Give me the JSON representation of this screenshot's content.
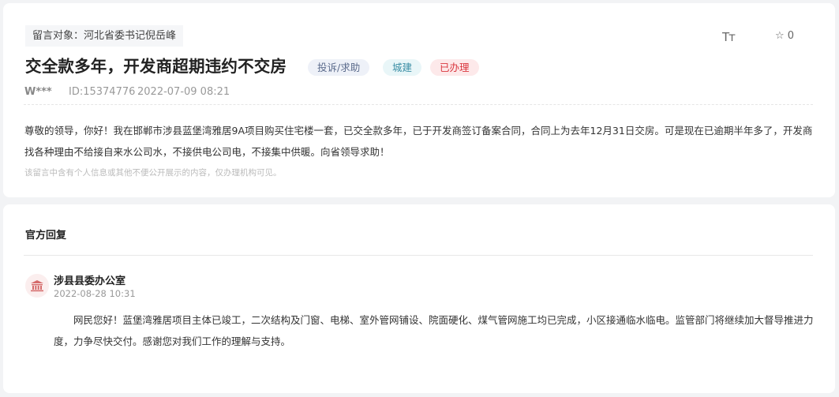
{
  "message": {
    "target": "留言对象：河北省委书记倪岳峰",
    "title": "交全款多年，开发商超期违约不交房",
    "tags": [
      "投诉/求助",
      "城建",
      "已办理"
    ],
    "font_size_icon_label": "Tт",
    "favorite_count": "☆ 0",
    "author": "W***",
    "id": "ID:15374776",
    "date": "2022-07-09 08:21",
    "content": "尊敬的领导，你好！我在邯郸市涉县蓝堡湾雅居9A项目购买住宅楼一套，已交全款多年，已于开发商签订备案合同，合同上为去年12月31日交房。可是现在已逾期半年多了，开发商找各种理由不给接自来水公司水，不接供电公司电，不接集中供暖。向省领导求助！",
    "privacy_note": "该留言中含有个人信息或其他不便公开展示的内容，仅办理机构可见。"
  },
  "reply": {
    "section_title": "官方回复",
    "org": "涉县县委办公室",
    "date": "2022-08-28 10:31",
    "content": "网民您好！蓝堡湾雅居项目主体已竣工，二次结构及门窗、电梯、室外管网铺设、院面硬化、煤气管网施工均已完成，小区接通临水临电。监管部门将继续加大督导推进力度，力争尽快交付。感谢您对我们工作的理解与支持。"
  },
  "colors": {
    "tag_type": "#5b6b8c",
    "tag_category": "#3b8ea5",
    "tag_status": "#d9363e",
    "avatar_icon": "#d56b6b"
  },
  "icons": {
    "font_size": "font-size-icon",
    "favorite": "star-icon",
    "org_avatar": "government-building-icon"
  }
}
